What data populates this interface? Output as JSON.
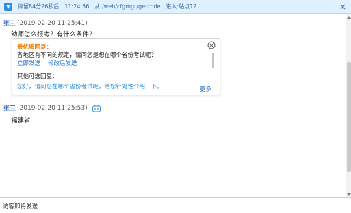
{
  "topbar": {
    "stay_text": "停留84分26秒后",
    "time_text": "11:24:36",
    "from_text": "从:/web/cfgmgr/getcode",
    "entry_text": "进入:站点12"
  },
  "messages": [
    {
      "sender": "张三",
      "timestamp": "(2019-02-20 11:25:41)",
      "text": "幼师怎么报考？有什么条件？"
    },
    {
      "sender": "张三",
      "timestamp": "(2019-02-20 11:25:53)",
      "text": "福建省"
    }
  ],
  "reply_card": {
    "best_title": "最优质回复：",
    "best_text": "各地区有不同的规定，请问您是想在哪个省份考试呢？",
    "send_now": "立即发送",
    "edit_send": "修改后发送",
    "other_title": "其他可选回复：",
    "other_text": "您好，请问您在哪个省份考试呢，给您针对性介绍一下。",
    "more": "更多"
  },
  "input": {
    "hint": "访客即将发送"
  },
  "colors": {
    "topbar_bg": "#dff0ff",
    "accent_blue": "#2c62b8",
    "link_blue": "#1f6fc7",
    "best_orange": "#f07d00"
  }
}
